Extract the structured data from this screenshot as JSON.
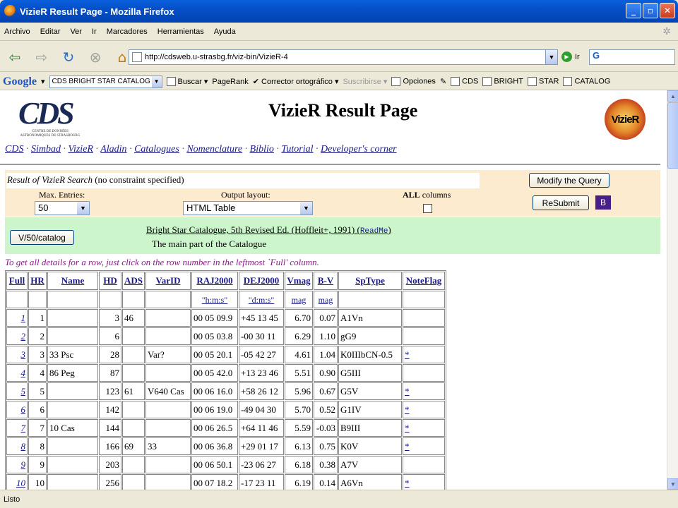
{
  "window": {
    "title": "VizieR Result Page - Mozilla Firefox"
  },
  "menu": [
    "Archivo",
    "Editar",
    "Ver",
    "Ir",
    "Marcadores",
    "Herramientas",
    "Ayuda"
  ],
  "address": {
    "url": "http://cdsweb.u-strasbg.fr/viz-bin/VizieR-4",
    "go_label": "Ir",
    "search_text": "G"
  },
  "google_toolbar": {
    "logo": "Google",
    "query": "CDS BRIGHT STAR CATALOG",
    "items": [
      "Buscar",
      "PageRank",
      "Corrector ortográfico",
      "Suscribirse",
      "Opciones",
      "CDS",
      "BRIGHT",
      "STAR",
      "CATALOG"
    ]
  },
  "page": {
    "title": "VizieR Result Page",
    "cds_logo": "CDS",
    "cds_logo_sub": "CENTRE DE DONNÉES ASTRONOMIQUES DE STRASBOURG",
    "vizier_logo": "VizieR",
    "nav_links": [
      "CDS",
      "Simbad",
      "VizieR",
      "Aladin",
      "Catalogues",
      "Nomenclature",
      "Biblio",
      "Tutorial",
      "Developer's corner"
    ]
  },
  "query": {
    "result_label": "Result of VizieR Search",
    "result_note": "(no constraint specified)",
    "max_entries_label": "Max. Entries:",
    "max_entries_value": "50",
    "output_layout_label": "Output layout:",
    "output_layout_value": "HTML Table",
    "all_columns_bold": "ALL",
    "all_columns_rest": " columns",
    "modify_button": "Modify the Query",
    "resubmit_button": "ReSubmit",
    "b_button": "B"
  },
  "catalog": {
    "id_button": "V/50/catalog",
    "name": "Bright Star Catalogue, 5th Revised Ed. (Hoffleit+, 1991)",
    "readme": "ReadMe",
    "description": "The main part of the Catalogue"
  },
  "hint": "To get all details for a row, just click on the row number in the leftmost `Full' column.",
  "table": {
    "headers": [
      "Full",
      "HR",
      "Name",
      "HD",
      "ADS",
      "VarID",
      "RAJ2000",
      "DEJ2000",
      "Vmag",
      "B-V",
      "SpType",
      "NoteFlag"
    ],
    "units": [
      "",
      "",
      "",
      "",
      "",
      "",
      "\"h:m:s\"",
      "\"d:m:s\"",
      "mag",
      "mag",
      "",
      ""
    ],
    "rows": [
      [
        "1",
        "1",
        "",
        "3",
        "46",
        "",
        "00 05 09.9",
        "+45 13 45",
        "6.70",
        "0.07",
        "A1Vn",
        ""
      ],
      [
        "2",
        "2",
        "",
        "6",
        "",
        "",
        "00 05 03.8",
        "-00 30 11",
        "6.29",
        "1.10",
        "gG9",
        ""
      ],
      [
        "3",
        "3",
        "33 Psc",
        "28",
        "",
        "Var?",
        "00 05 20.1",
        "-05 42 27",
        "4.61",
        "1.04",
        "K0IIIbCN-0.5",
        "*"
      ],
      [
        "4",
        "4",
        "86 Peg",
        "87",
        "",
        "",
        "00 05 42.0",
        "+13 23 46",
        "5.51",
        "0.90",
        "G5III",
        ""
      ],
      [
        "5",
        "5",
        "",
        "123",
        "61",
        "V640 Cas",
        "00 06 16.0",
        "+58 26 12",
        "5.96",
        "0.67",
        "G5V",
        "*"
      ],
      [
        "6",
        "6",
        "",
        "142",
        "",
        "",
        "00 06 19.0",
        "-49 04 30",
        "5.70",
        "0.52",
        "G1IV",
        "*"
      ],
      [
        "7",
        "7",
        "10 Cas",
        "144",
        "",
        "",
        "00 06 26.5",
        "+64 11 46",
        "5.59",
        "-0.03",
        "B9III",
        "*"
      ],
      [
        "8",
        "8",
        "",
        "166",
        "69",
        "33",
        "00 06 36.8",
        "+29 01 17",
        "6.13",
        "0.75",
        "K0V",
        "*"
      ],
      [
        "9",
        "9",
        "",
        "203",
        "",
        "",
        "00 06 50.1",
        "-23 06 27",
        "6.18",
        "0.38",
        "A7V",
        ""
      ],
      [
        "10",
        "10",
        "",
        "256",
        "",
        "",
        "00 07 18.2",
        "-17 23 11",
        "6.19",
        "0.14",
        "A6Vn",
        "*"
      ]
    ]
  },
  "status": "Listo"
}
